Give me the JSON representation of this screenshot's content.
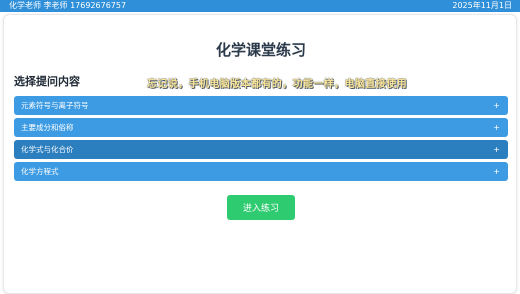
{
  "topbar": {
    "teacher_info": "化学老师 李老师 17692676757",
    "date": "2025年11月1日"
  },
  "main": {
    "title": "化学课堂练习",
    "section_title": "选择提问内容",
    "notice": "忘记说，手机电脑版本都有的，功能一样，电脑直接使用",
    "topics": [
      {
        "label": "元素符号与离子符号",
        "toggle": "+"
      },
      {
        "label": "主要成分和俗称",
        "toggle": "+"
      },
      {
        "label": "化学式与化合价",
        "toggle": "+"
      },
      {
        "label": "化学方程式",
        "toggle": "+"
      }
    ],
    "enter_button": "进入练习"
  },
  "colors": {
    "topbar": "#2f8fd8",
    "accordion": "#3d9be3",
    "accordion_active": "#2c7fbf",
    "button": "#2fcb71",
    "notice_text": "#fbe69a"
  }
}
